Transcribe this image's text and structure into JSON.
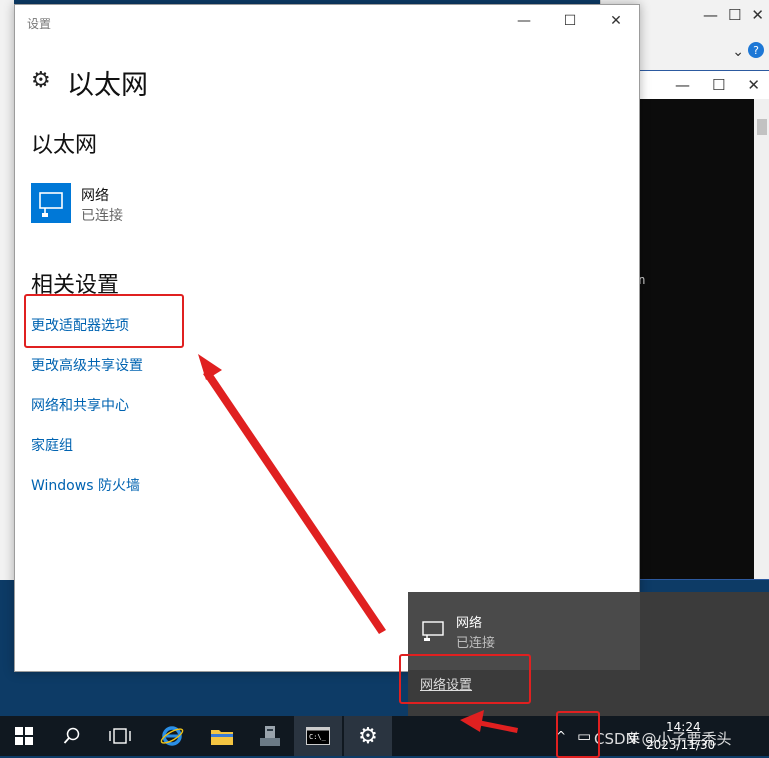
{
  "background_window": {
    "minimize": "—",
    "maximize": "☐",
    "close": "✕",
    "help": "?"
  },
  "console": {
    "minimize": "—",
    "maximize": "☐",
    "close": "✕",
    "fragment": "on"
  },
  "settings": {
    "window_title": "设置",
    "minimize": "—",
    "maximize": "☐",
    "close": "✕",
    "page_title": "以太网",
    "section_ethernet": "以太网",
    "network": {
      "name": "网络",
      "status": "已连接"
    },
    "section_related": "相关设置",
    "links": [
      "更改适配器选项",
      "更改高级共享设置",
      "网络和共享中心",
      "家庭组",
      "Windows 防火墙"
    ]
  },
  "flyout": {
    "network_name": "网络",
    "network_status": "已连接",
    "settings_link": "网络设置"
  },
  "taskbar": {
    "tray": {
      "ime": "英",
      "time": "14:24",
      "date": "2023/11/30",
      "watermark": "CSDN @小子要秃头"
    }
  },
  "colors": {
    "accent": "#0078d7",
    "link": "#0063b1",
    "annotation": "#e02020"
  }
}
